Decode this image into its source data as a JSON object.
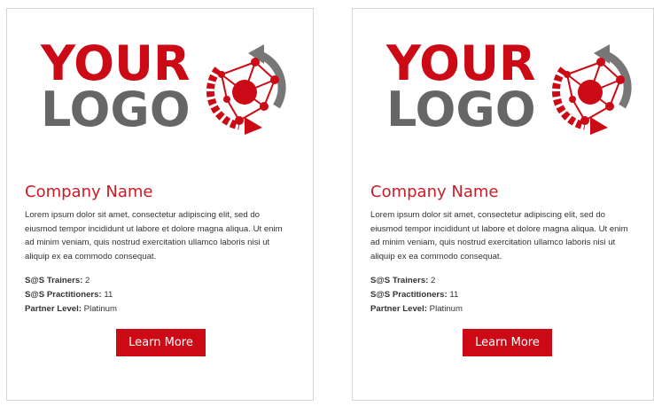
{
  "cards": [
    {
      "logo": {
        "line1": "YOUR",
        "line2": "LOGO"
      },
      "company_name": "Company Name",
      "description": "Lorem ipsum dolor sit amet, consectetur adipiscing elit, sed do eiusmod tempor incididunt ut labore et dolore magna aliqua. Ut enim ad minim veniam, quis nostrud exercitation ullamco laboris nisi ut aliquip ex ea commodo consequat.",
      "stats": [
        {
          "label": "S@S Trainers:",
          "value": "2"
        },
        {
          "label": "S@S Practitioners:",
          "value": "11"
        },
        {
          "label": "Partner Level:",
          "value": "Platinum"
        }
      ],
      "button_label": "Learn More"
    },
    {
      "logo": {
        "line1": "YOUR",
        "line2": "LOGO"
      },
      "company_name": "Company Name",
      "description": "Lorem ipsum dolor sit amet, consectetur adipiscing elit, sed do eiusmod tempor incididunt ut labore et dolore magna aliqua. Ut enim ad minim veniam, quis nostrud exercitation ullamco laboris nisi ut aliquip ex ea commodo consequat.",
      "stats": [
        {
          "label": "S@S Trainers:",
          "value": "2"
        },
        {
          "label": "S@S Practitioners:",
          "value": "11"
        },
        {
          "label": "Partner Level:",
          "value": "Platinum"
        }
      ],
      "button_label": "Learn More"
    }
  ],
  "colors": {
    "accent": "#cc0a16",
    "logo_gray": "#666666",
    "border": "#d6d6d6"
  },
  "icons": {
    "logo_mark": "network-circle-arrows-icon"
  }
}
